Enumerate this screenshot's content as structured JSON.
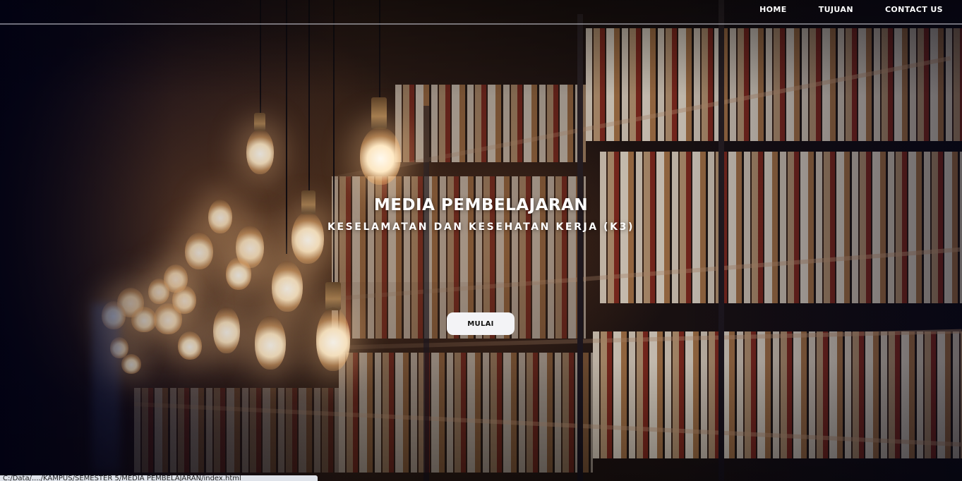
{
  "nav": {
    "items": [
      {
        "label": "HOME"
      },
      {
        "label": "TUJUAN"
      },
      {
        "label": "CONTACT US"
      }
    ]
  },
  "hero": {
    "title": "MEDIA PEMBELAJARAN",
    "subtitle": "KESELAMATAN DAN KESEHATAN KERJA (K3)",
    "button_label": "MULAI",
    "background": "library-bookshelf-with-hanging-light-bulbs"
  },
  "status_bar": {
    "text": "C:/Data/..../KAMPUS/SEMESTER 5/MEDIA PEMBELAJARAN/index.html"
  },
  "colors": {
    "text": "#ffffff",
    "button_bg": "#f3f3f6",
    "button_text": "#111111",
    "nav_rule": "#c8c8d2"
  }
}
